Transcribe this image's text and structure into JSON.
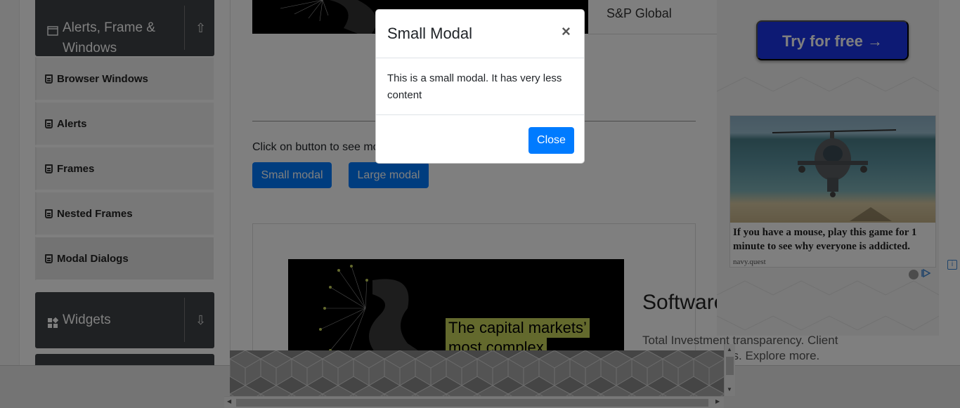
{
  "sidebar": {
    "group_alerts": {
      "title": "Alerts, Frame & Windows",
      "arrow": "⇧"
    },
    "items": [
      {
        "label": "Browser Windows"
      },
      {
        "label": "Alerts"
      },
      {
        "label": "Frames"
      },
      {
        "label": "Nested Frames"
      },
      {
        "label": "Modal Dialogs"
      }
    ],
    "group_widgets": {
      "title": "Widgets",
      "arrow": "⇩"
    }
  },
  "main": {
    "company": "S&P Global",
    "instruction": "Click on button to see modal",
    "small_modal_button": "Small modal",
    "large_modal_button": "Large modal"
  },
  "ad_main": {
    "headline_1": "The capital markets’",
    "headline_2": "most complex",
    "title": "Software",
    "description": "Total Investment transparency. Client lifecycle data silos. Explore more."
  },
  "ad_right": {
    "try_button": "Try for free →",
    "caption": "If you have a mouse, play this game for 1 minute to see why everyone is addicted.",
    "source": "navy.quest",
    "info": "i"
  },
  "modal": {
    "title": "Small Modal",
    "close_x": "×",
    "body": "This is a small modal. It has very less content",
    "close_button": "Close"
  },
  "colors": {
    "primary": "#007bff",
    "sidebar_header": "#3f4346",
    "try_button": "#1a35e8",
    "ad_highlight": "#c7d35a"
  }
}
